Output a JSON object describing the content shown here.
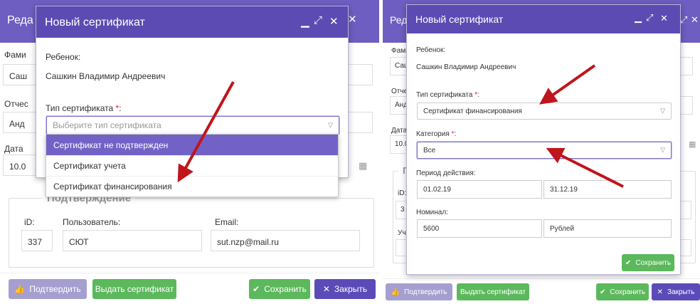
{
  "left": {
    "background_dialog": {
      "title": "Реда",
      "labels": {
        "surname": "Фами",
        "patronymic": "Отчес",
        "date": "Дата"
      },
      "values": {
        "surname": "Саш",
        "patronymic": "Анд",
        "date": "10.0"
      },
      "fieldset": {
        "legend": "Подтверждение",
        "id_label": "iD:",
        "user_label": "Пользователь:",
        "email_label": "Email:",
        "id_value": "337",
        "user_value": "СЮТ",
        "email_value": "sut.nzp@mail.ru"
      },
      "footer": {
        "confirm": "Подтвердить",
        "issue": "Выдать сертификат",
        "save": "Сохранить",
        "close": "Закрыть"
      }
    },
    "modal": {
      "title": "Новый сертификат",
      "child_label": "Ребенок:",
      "child_name": "Сашкин Владимир Андреевич",
      "type_label": "Тип сертификата",
      "required": "*",
      "colon": ":",
      "type_placeholder": "Выберите тип сертификата",
      "options": [
        "Сертификат не подтвержден",
        "Сертификат учета",
        "Сертификат финансирования"
      ],
      "active_option_index": 0
    }
  },
  "right": {
    "background_dialog": {
      "title": "Реда",
      "labels": {
        "surname": "Фами",
        "patronymic": "Отче",
        "date": "Дата",
        "id": "iD:",
        "inst": "Учр"
      },
      "values": {
        "surname": "Саш",
        "patronymic": "Анд",
        "date": "10.0",
        "id": "3",
        "inst": ""
      },
      "fieldset_legend": "П",
      "footer": {
        "confirm": "Подтвердить",
        "issue": "Выдать сертификат",
        "save": "Сохранить",
        "close": "Закрыть"
      }
    },
    "modal": {
      "title": "Новый сертификат",
      "child_label": "Ребенок:",
      "child_name": "Сашкин Владимир Андреевич",
      "type_label": "Тип сертификата",
      "type_value": "Сертификат финансирования",
      "category_label": "Категория",
      "category_value": "Все",
      "required": "*",
      "colon": ":",
      "period_label": "Период действия:",
      "period_from": "01.02.19",
      "period_to": "31.12.19",
      "nominal_label": "Номинал:",
      "nominal_value": "5600",
      "currency": "Рублей",
      "save": "Сохранить"
    }
  },
  "colors": {
    "header": "#6e5ec1",
    "modal_header": "#5c4bb3",
    "green": "#5cb85c",
    "purple_button": "#5b4bb8",
    "dropdown_active": "#7262c6",
    "required": "#e02020",
    "arrow": "#c0151a"
  }
}
